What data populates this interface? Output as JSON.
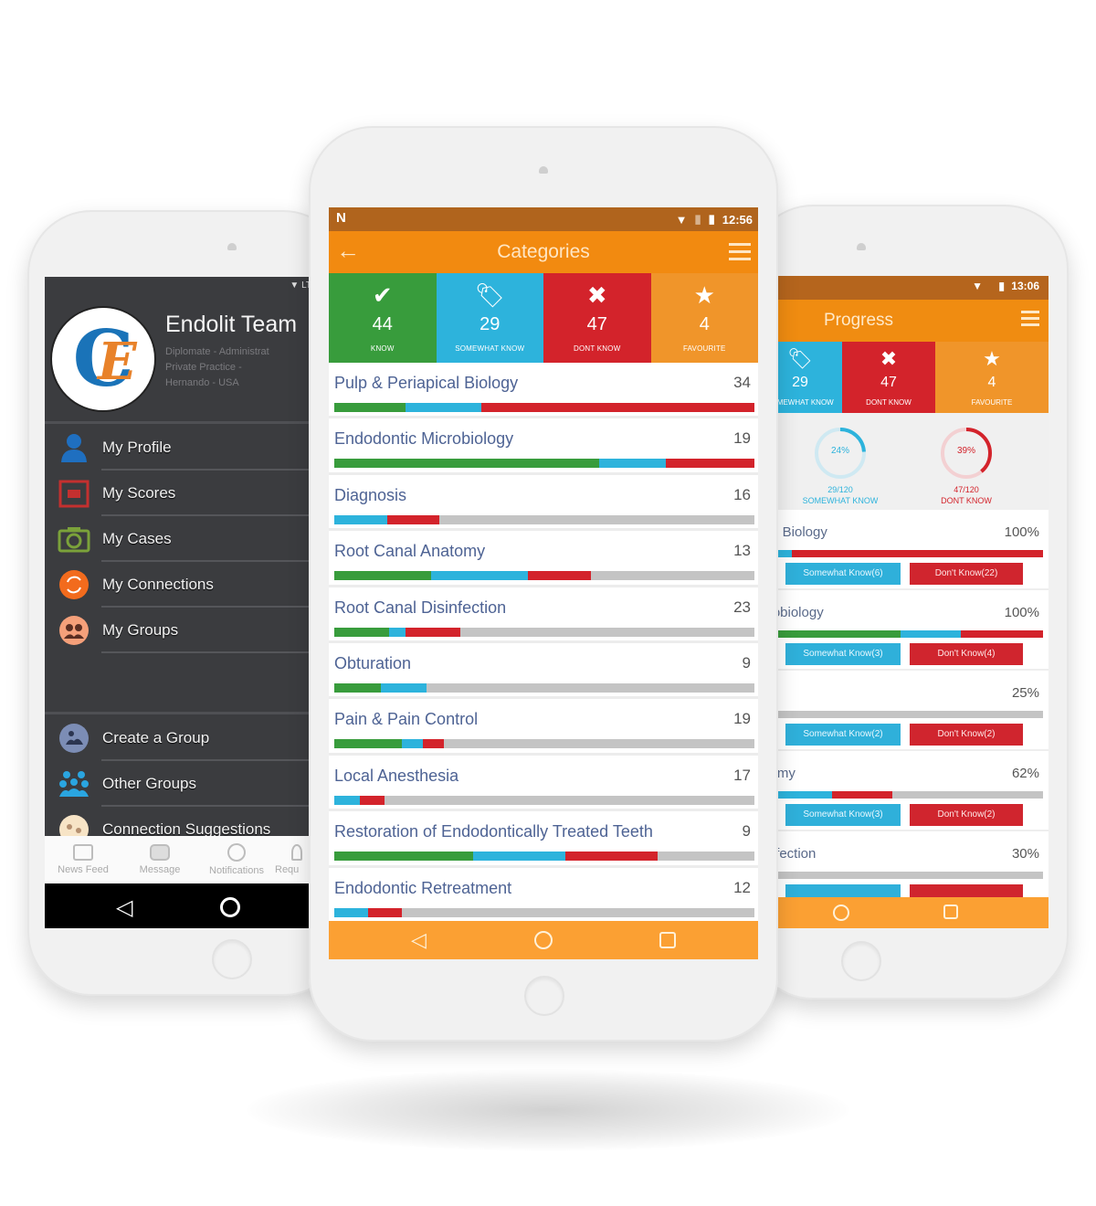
{
  "colors": {
    "know": "#389c3c",
    "somewhat": "#2db3dc",
    "dont_know": "#d3232b",
    "favourite": "#f0952a",
    "app_bar": "#f28a10",
    "status_bar": "#b0641d",
    "nav_bar": "#fba033",
    "drawer_bg": "#3b3c3f"
  },
  "left_phone": {
    "profile": {
      "name": "Endolit Team",
      "subtitle_lines": [
        "Diplomate - Administrat",
        "Private Practice -",
        "Hernando - USA"
      ]
    },
    "status_text": "LT",
    "menu_primary": [
      {
        "label": "My Profile",
        "icon": "user-icon"
      },
      {
        "label": "My Scores",
        "icon": "scores-icon"
      },
      {
        "label": "My Cases",
        "icon": "camera-icon"
      },
      {
        "label": "My Connections",
        "icon": "connections-icon"
      },
      {
        "label": "My Groups",
        "icon": "groups-icon"
      }
    ],
    "menu_secondary": [
      {
        "label": "Create a Group",
        "icon": "create-group-icon"
      },
      {
        "label": "Other Groups",
        "icon": "other-groups-icon"
      },
      {
        "label": "Connection Suggestions",
        "icon": "suggestions-icon"
      }
    ],
    "bottom_tabs": [
      {
        "label": "News Feed",
        "icon": "newsfeed-icon"
      },
      {
        "label": "Message",
        "icon": "message-icon"
      },
      {
        "label": "Notifications",
        "icon": "notifications-icon"
      },
      {
        "label": "Requ",
        "icon": "requests-icon"
      }
    ]
  },
  "center_phone": {
    "status": {
      "time": "12:56"
    },
    "title": "Categories",
    "tiles": [
      {
        "icon": "check-icon",
        "glyph": "✔",
        "count": "44",
        "label": "KNOW",
        "color": "#389c3c"
      },
      {
        "icon": "tag-icon",
        "glyph": "🏷",
        "count": "29",
        "label": "SOMEWHAT KNOW",
        "color": "#2db3dc"
      },
      {
        "icon": "cross-icon",
        "glyph": "✖",
        "count": "47",
        "label": "DONT KNOW",
        "color": "#d3232b"
      },
      {
        "icon": "star-icon",
        "glyph": "★",
        "count": "4",
        "label": "FAVOURITE",
        "color": "#f0952a"
      }
    ],
    "categories": [
      {
        "name": "Pulp & Periapical Biology",
        "count": "34",
        "know": 0.17,
        "somewhat": 0.18,
        "dont": 0.65
      },
      {
        "name": "Endodontic Microbiology",
        "count": "19",
        "know": 0.63,
        "somewhat": 0.16,
        "dont": 0.21
      },
      {
        "name": "Diagnosis",
        "count": "16",
        "know": 0.0,
        "somewhat": 0.125,
        "dont": 0.125
      },
      {
        "name": "Root Canal Anatomy",
        "count": "13",
        "know": 0.23,
        "somewhat": 0.23,
        "dont": 0.15
      },
      {
        "name": "Root Canal Disinfection",
        "count": "23",
        "know": 0.13,
        "somewhat": 0.04,
        "dont": 0.13
      },
      {
        "name": "Obturation",
        "count": "9",
        "know": 0.11,
        "somewhat": 0.11,
        "dont": 0.0
      },
      {
        "name": "Pain & Pain Control",
        "count": "19",
        "know": 0.16,
        "somewhat": 0.05,
        "dont": 0.05
      },
      {
        "name": "Local Anesthesia",
        "count": "17",
        "know": 0.0,
        "somewhat": 0.06,
        "dont": 0.06
      },
      {
        "name": "Restoration of Endodontically Treated Teeth",
        "count": "9",
        "know": 0.33,
        "somewhat": 0.22,
        "dont": 0.22
      },
      {
        "name": "Endodontic Retreatment",
        "count": "12",
        "know": 0.0,
        "somewhat": 0.08,
        "dont": 0.08
      }
    ]
  },
  "right_phone": {
    "status": {
      "time": "13:06"
    },
    "title": "Progress",
    "tiles": [
      {
        "icon": "tag-icon",
        "glyph": "🏷",
        "count": "29",
        "label": "SOMEWHAT KNOW",
        "color": "#2db3dc"
      },
      {
        "icon": "cross-icon",
        "glyph": "✖",
        "count": "47",
        "label": "DONT KNOW",
        "color": "#d3232b"
      },
      {
        "icon": "star-icon",
        "glyph": "★",
        "count": "4",
        "label": "FAVOURITE",
        "color": "#f0952a"
      }
    ],
    "rings": [
      {
        "percent": "24%",
        "value": 0.24,
        "fraction": "29/120",
        "label": "SOMEWHAT KNOW",
        "color": "#2db3dc",
        "track": "#cfe9f2"
      },
      {
        "percent": "39%",
        "value": 0.39,
        "fraction": "47/120",
        "label": "DONT KNOW",
        "color": "#d3232b",
        "track": "#f3d0d2"
      }
    ],
    "rows": [
      {
        "name": "ical Biology",
        "percent": "100%",
        "know": 0.0,
        "somewhat": 0.12,
        "dont": 0.88,
        "somewhat_btn": "Somewhat Know(6)",
        "dont_btn": "Don't Know(22)"
      },
      {
        "name": "icrobiology",
        "percent": "100%",
        "know": 0.5,
        "somewhat": 0.21,
        "dont": 0.29,
        "somewhat_btn": "Somewhat Know(3)",
        "dont_btn": "Don't Know(4)"
      },
      {
        "name": "",
        "percent": "25%",
        "know": 0.0,
        "somewhat": 0.0,
        "dont": 0.0,
        "somewhat_btn": "Somewhat Know(2)",
        "dont_btn": "Don't Know(2)"
      },
      {
        "name": "atomy",
        "percent": "62%",
        "know": 0.0,
        "somewhat": 0.26,
        "dont": 0.21,
        "somewhat_btn": "Somewhat Know(3)",
        "dont_btn": "Don't Know(2)"
      },
      {
        "name": "sinfection",
        "percent": "30%",
        "know": 0.0,
        "somewhat": 0.0,
        "dont": 0.04,
        "somewhat_btn": "",
        "dont_btn": ""
      }
    ]
  }
}
